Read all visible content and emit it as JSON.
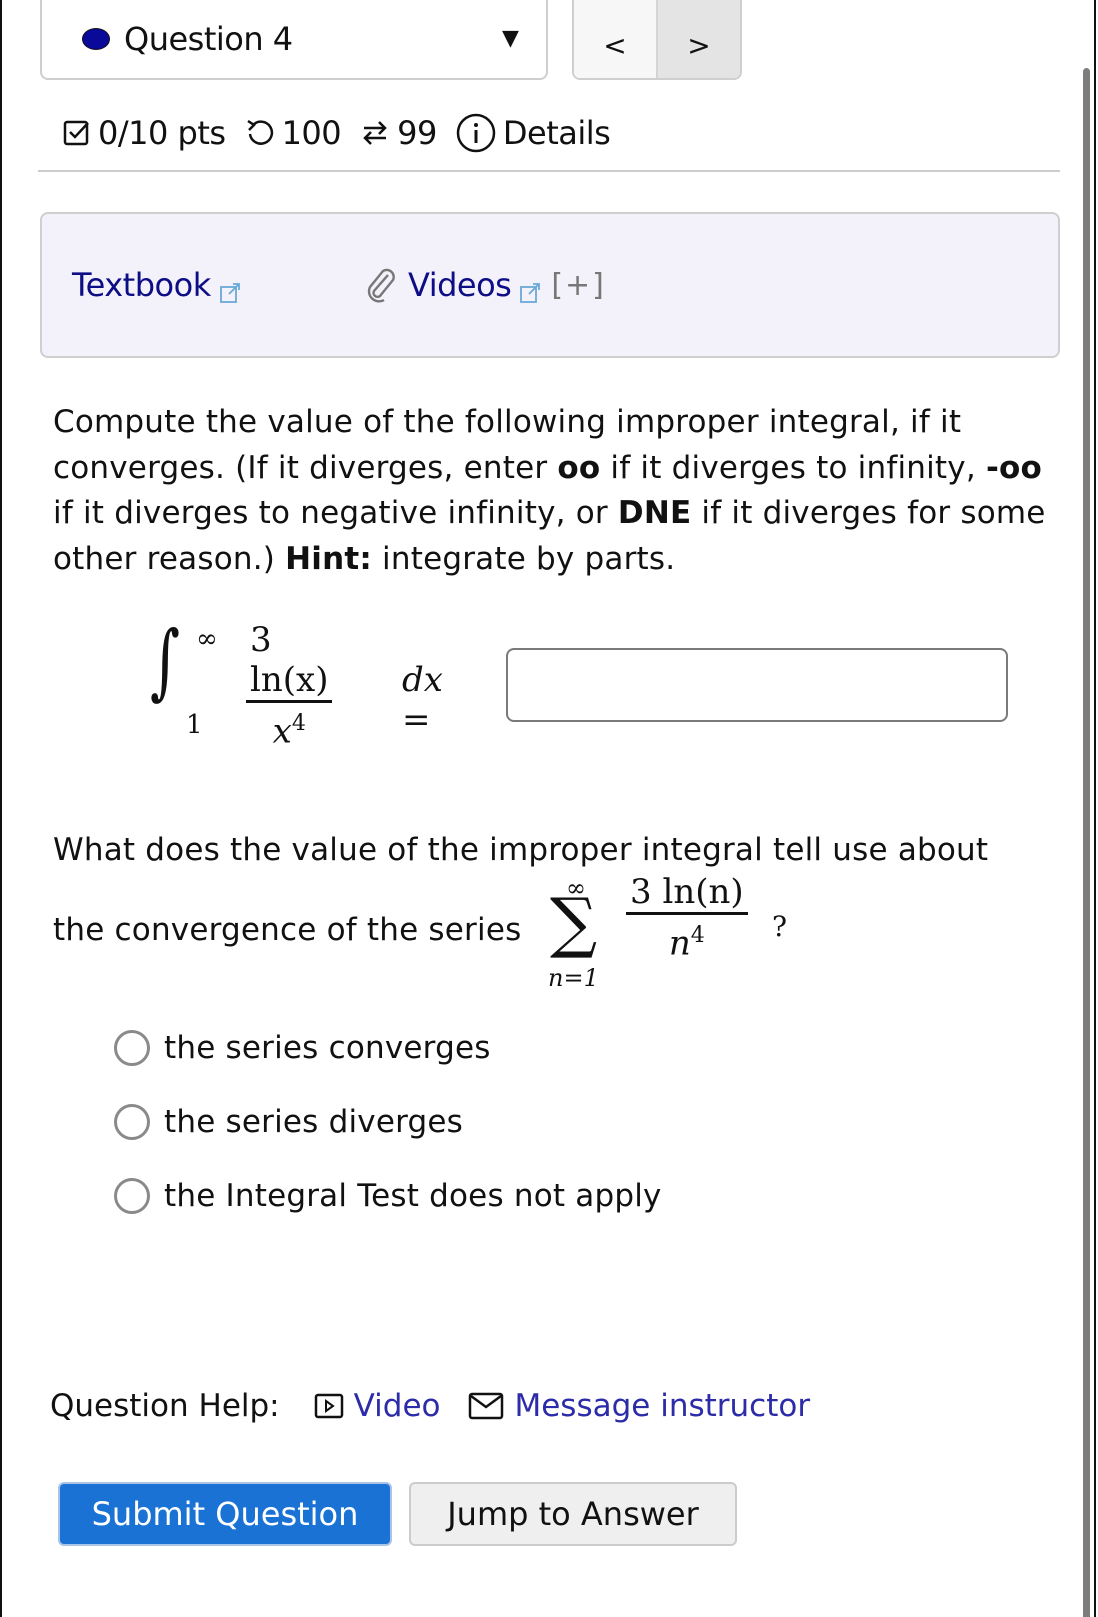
{
  "header": {
    "question_selector": {
      "label": "Question 4",
      "status_color": "#0a0a9a"
    },
    "nav": {
      "prev_label": "<",
      "next_label": ">"
    }
  },
  "meta": {
    "score": "0/10 pts",
    "retries": "100",
    "attempts": "99",
    "details_label": "Details"
  },
  "resources": {
    "textbook_label": "Textbook",
    "videos_label": "Videos",
    "expand_label": "[+]"
  },
  "problem": {
    "seg1": "Compute the value of the following improper integral, if it converges. (If it diverges, enter ",
    "bold1": "oo",
    "seg2": " if it diverges to infinity, ",
    "bold2": "-oo",
    "seg3": " if it diverges to negative infinity, or ",
    "bold3": "DNE",
    "seg4": " if it diverges for some other reason.) ",
    "bold4": "Hint:",
    "seg5": " integrate by parts."
  },
  "integral": {
    "upper": "∞",
    "lower": "1",
    "numerator": "3 ln(x)",
    "denominator_base": "x",
    "denominator_exp": "4",
    "differential": "dx =",
    "answer_value": ""
  },
  "question2": {
    "line1": "What does the value of the improper integral tell use about",
    "line2": "the convergence of the series",
    "sum_upper": "∞",
    "sum_lower": "n=1",
    "numerator": "3 ln(n)",
    "denominator_base": "n",
    "denominator_exp": "4",
    "end": "?",
    "options": [
      {
        "label": "the series converges",
        "selected": false
      },
      {
        "label": "the series diverges",
        "selected": false
      },
      {
        "label": "the Integral Test does not apply",
        "selected": false
      }
    ]
  },
  "help": {
    "label": "Question Help:",
    "video_label": "Video",
    "message_label": "Message instructor"
  },
  "actions": {
    "submit_label": "Submit Question",
    "jump_label": "Jump to Answer"
  }
}
